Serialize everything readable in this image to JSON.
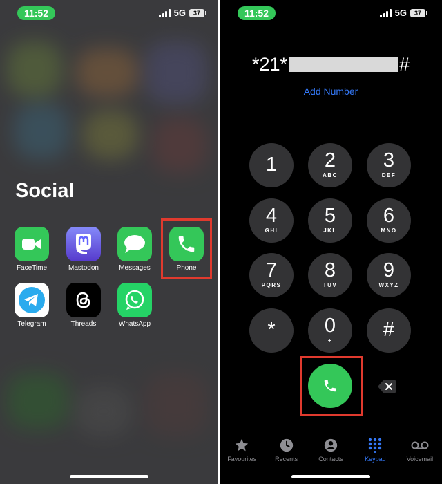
{
  "left_screen": {
    "status": {
      "time": "11:52",
      "network": "5G",
      "battery": "37"
    },
    "folder_title": "Social",
    "apps": [
      {
        "label": "FaceTime",
        "icon": "facetime-icon",
        "color": "#34c759"
      },
      {
        "label": "Mastodon",
        "icon": "mastodon-icon",
        "color": "#6364ff"
      },
      {
        "label": "Messages",
        "icon": "messages-icon",
        "color": "#34c759"
      },
      {
        "label": "Phone",
        "icon": "phone-icon",
        "color": "#34c759",
        "highlighted": true
      },
      {
        "label": "Telegram",
        "icon": "telegram-icon",
        "color": "#2aabee"
      },
      {
        "label": "Threads",
        "icon": "threads-icon",
        "color": "#000000"
      },
      {
        "label": "WhatsApp",
        "icon": "whatsapp-icon",
        "color": "#25d366"
      }
    ]
  },
  "right_screen": {
    "status": {
      "time": "11:52",
      "network": "5G",
      "battery": "37"
    },
    "dialed_prefix": "*21*",
    "dialed_suffix": "#",
    "add_number": "Add Number",
    "keypad": [
      {
        "digit": "1",
        "letters": ""
      },
      {
        "digit": "2",
        "letters": "ABC"
      },
      {
        "digit": "3",
        "letters": "DEF"
      },
      {
        "digit": "4",
        "letters": "GHI"
      },
      {
        "digit": "5",
        "letters": "JKL"
      },
      {
        "digit": "6",
        "letters": "MNO"
      },
      {
        "digit": "7",
        "letters": "PQRS"
      },
      {
        "digit": "8",
        "letters": "TUV"
      },
      {
        "digit": "9",
        "letters": "WXYZ"
      },
      {
        "digit": "*",
        "letters": ""
      },
      {
        "digit": "0",
        "letters": "+"
      },
      {
        "digit": "#",
        "letters": ""
      }
    ],
    "tabs": [
      {
        "label": "Favourites",
        "icon": "star-icon",
        "active": false
      },
      {
        "label": "Recents",
        "icon": "clock-icon",
        "active": false
      },
      {
        "label": "Contacts",
        "icon": "contact-icon",
        "active": false
      },
      {
        "label": "Keypad",
        "icon": "keypad-icon",
        "active": true
      },
      {
        "label": "Voicemail",
        "icon": "voicemail-icon",
        "active": false
      }
    ]
  },
  "colors": {
    "accent_green": "#34c759",
    "accent_blue": "#3478f6",
    "highlight_red": "#e03a2e",
    "key_gray": "#333335"
  }
}
